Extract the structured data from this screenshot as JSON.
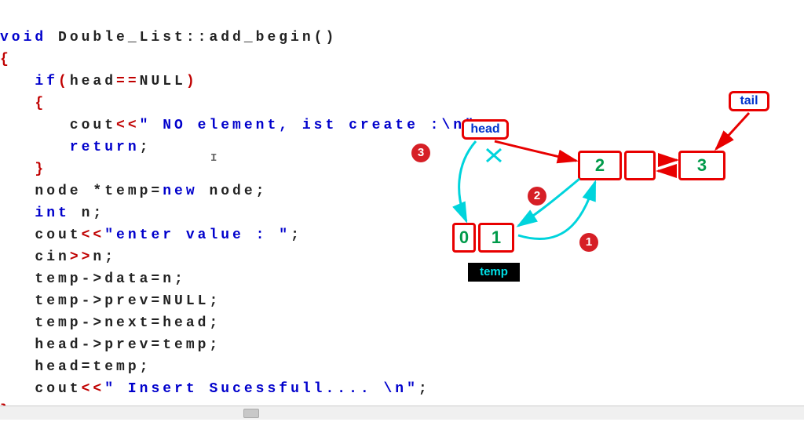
{
  "code": {
    "l1_kw_void": "void",
    "l1_id": " Double_List::add_begin()",
    "l2_brace": "{",
    "l3_kw_if": "   if",
    "l3_paren_o": "(",
    "l3_head": "head",
    "l3_eq": "==",
    "l3_null": "NULL",
    "l3_paren_c": ")",
    "l4_brace": "   {",
    "l5_cout": "      cout",
    "l5_ins": "<<",
    "l5_str": "\" NO element, ist create :\\n\"",
    "l5_semi": ";",
    "l6_ret": "      return",
    "l6_semi": ";",
    "l7_brace": "   }",
    "l8_node": "   node *temp=",
    "l8_new": "new",
    "l8_rest": " node;",
    "l9_int": "   int",
    "l9_n": " n;",
    "l10_cout": "   cout",
    "l10_ins": "<<",
    "l10_str": "\"enter value : \"",
    "l10_semi": ";",
    "l11_cin": "   cin",
    "l11_ext": ">>",
    "l11_n": "n;",
    "l12": "   temp->data=n;",
    "l13a": "   temp->prev=",
    "l13b": "NULL",
    "l13c": ";",
    "l14": "   temp->next=head;",
    "l15": "   head->prev=temp;",
    "l16": "   head=temp;",
    "l17_cout": "   cout",
    "l17_ins": "<<",
    "l17_str": "\" Insert Sucessfull.... \\n\"",
    "l17_semi": ";",
    "l18_brace": "}"
  },
  "diagram": {
    "head_label": "head",
    "tail_label": "tail",
    "temp_label": "temp",
    "node_temp_prev": "0",
    "node_temp_val": "1",
    "node2_val": "2",
    "node3_val": "3",
    "step1": "1",
    "step2": "2",
    "step3": "3"
  },
  "chart_data": {
    "type": "diagram",
    "description": "Doubly linked list insertion at beginning",
    "nodes": [
      {
        "name": "temp",
        "prev": 0,
        "value": 1,
        "next_points_to": "node2"
      },
      {
        "name": "node2",
        "value": 2,
        "prev_points_to": "temp",
        "next_points_to": "node3"
      },
      {
        "name": "node3",
        "value": 3,
        "prev_points_to": "node2"
      }
    ],
    "pointers": {
      "head_before": "node2",
      "head_after": "temp",
      "tail": "node3"
    },
    "steps": [
      {
        "n": 1,
        "action": "temp->next = head (points temp to node2)"
      },
      {
        "n": 2,
        "action": "head->prev = temp (node2 prev points to temp)"
      },
      {
        "n": 3,
        "action": "head = temp (head now points to temp)"
      }
    ]
  }
}
